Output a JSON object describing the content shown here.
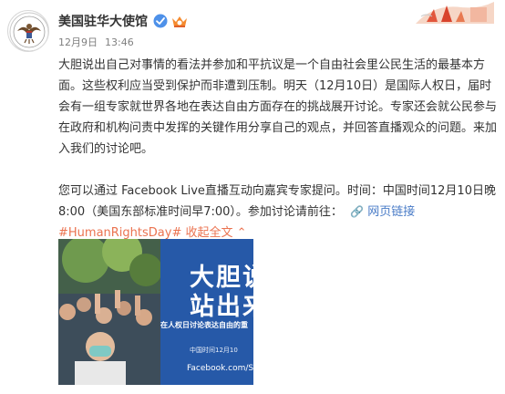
{
  "author": {
    "name": "美国驻华大使馆",
    "avatar_icon": "embassy-seal-icon",
    "verified_icon": "verified-badge-icon",
    "vip_icon": "vip-member-icon"
  },
  "meta": {
    "date": "12月9日",
    "time": "13:46"
  },
  "post": {
    "paragraph_1": "大胆说出自己对事情的看法并参加和平抗议是一个自由社会里公民生活的最基本方面。这些权利应当受到保护而非遭到压制。明天（12月10日）是国际人权日，届时会有一组专家就世界各地在表达自由方面存在的挑战展开讨论。专家还会就公民参与在政府和机构问责中发挥的关键作用分享自己的观点，并回答直播观众的问题。来加入我们的讨论吧。",
    "paragraph_2": "您可以通过 Facebook Live直播互动向嘉宾专家提问。时间：中国时间12月10日晚8:00（美国东部标准时间早7:00）。参加讨论请前往：",
    "web_link_icon": "link-icon",
    "web_link_label": "网页链接",
    "hashtag": "#HumanRightsDay#",
    "collapse_label": "收起全文",
    "collapse_icon": "chevron-up-icon"
  },
  "photo": {
    "headline_1": "大胆说",
    "headline_2": "站出来",
    "subtitle": "在人权日讨论表达自由的重",
    "date_line": "中国时间12月10",
    "url": "Facebook.com/Sta"
  },
  "colors": {
    "link": "#eb7350",
    "web_link": "#4a7cc7",
    "photo_blue": "#2659a8"
  }
}
